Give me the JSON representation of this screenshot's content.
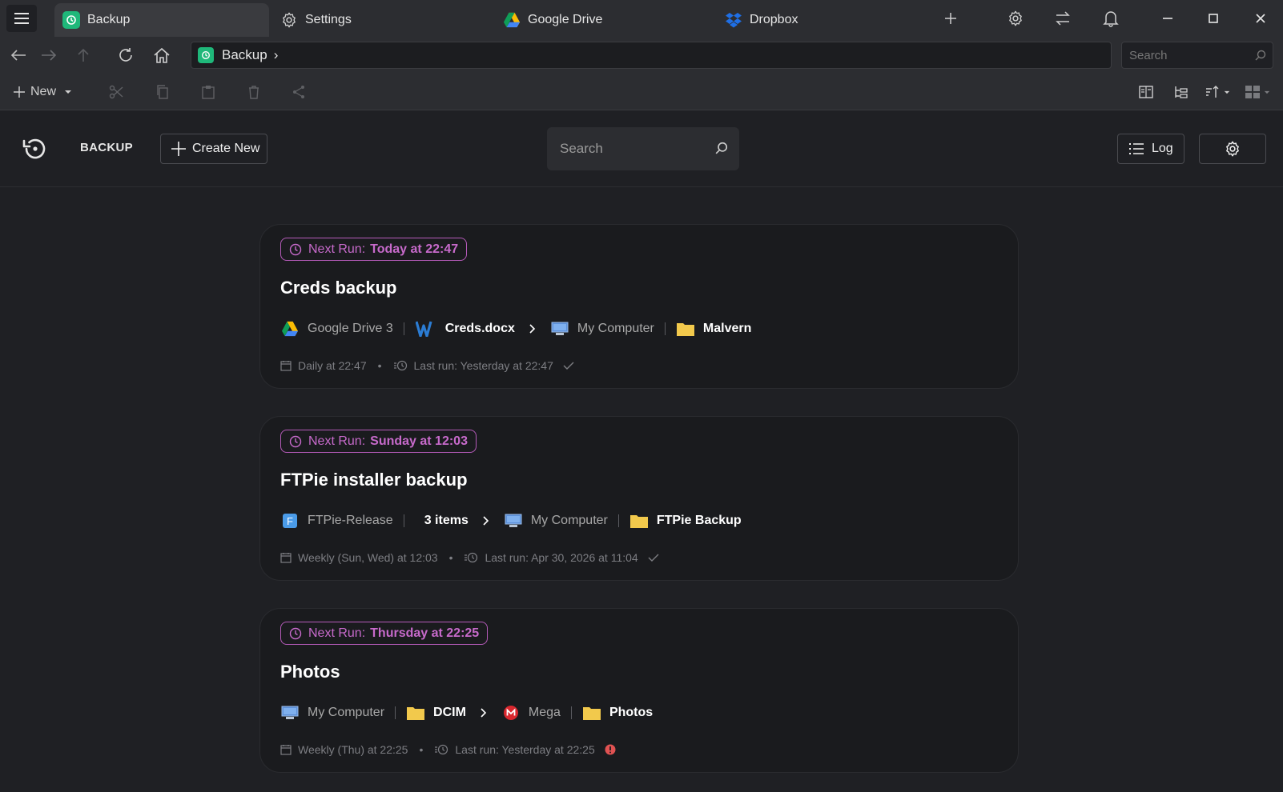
{
  "tabs": [
    {
      "label": "Backup",
      "icon": "backup-icon"
    },
    {
      "label": "Settings",
      "icon": "gear-icon"
    },
    {
      "label": "Google Drive",
      "icon": "google-drive-icon"
    },
    {
      "label": "Dropbox",
      "icon": "dropbox-icon"
    }
  ],
  "address": {
    "label": "Backup",
    "chevron": "›"
  },
  "top_search": {
    "placeholder": "Search"
  },
  "toolbar": {
    "new_label": "New"
  },
  "header": {
    "title": "BACKUP",
    "create_label": "Create New",
    "search_placeholder": "Search",
    "log_label": "Log"
  },
  "jobs": [
    {
      "next_run_label": "Next Run:",
      "next_run_value": "Today at 22:47",
      "title": "Creds backup",
      "source_service": "Google Drive 3",
      "source_item": "Creds.docx",
      "dest_service": "My Computer",
      "dest_item": "Malvern",
      "schedule": "Daily at 22:47",
      "last_run": "Last run: Yesterday at 22:47",
      "status": "success"
    },
    {
      "next_run_label": "Next Run:",
      "next_run_value": "Sunday at 12:03",
      "title": "FTPie installer backup",
      "source_service": "FTPie-Release",
      "source_item": "3 items",
      "dest_service": "My Computer",
      "dest_item": "FTPie Backup",
      "schedule": "Weekly (Sun, Wed) at 12:03",
      "last_run": "Last run: Apr 30, 2026 at 11:04",
      "status": "success"
    },
    {
      "next_run_label": "Next Run:",
      "next_run_value": "Thursday at 22:25",
      "title": "Photos",
      "source_service": "My Computer",
      "source_item": "DCIM",
      "dest_service": "Mega",
      "dest_item": "Photos",
      "schedule": "Weekly (Thu) at 22:25",
      "last_run": "Last run: Yesterday at 22:25",
      "status": "error"
    }
  ],
  "colors": {
    "accent": "#c76acb",
    "success": "#7d7e83",
    "error": "#e05252",
    "folder": "#f2c94c",
    "brand_green": "#1fb87a"
  }
}
